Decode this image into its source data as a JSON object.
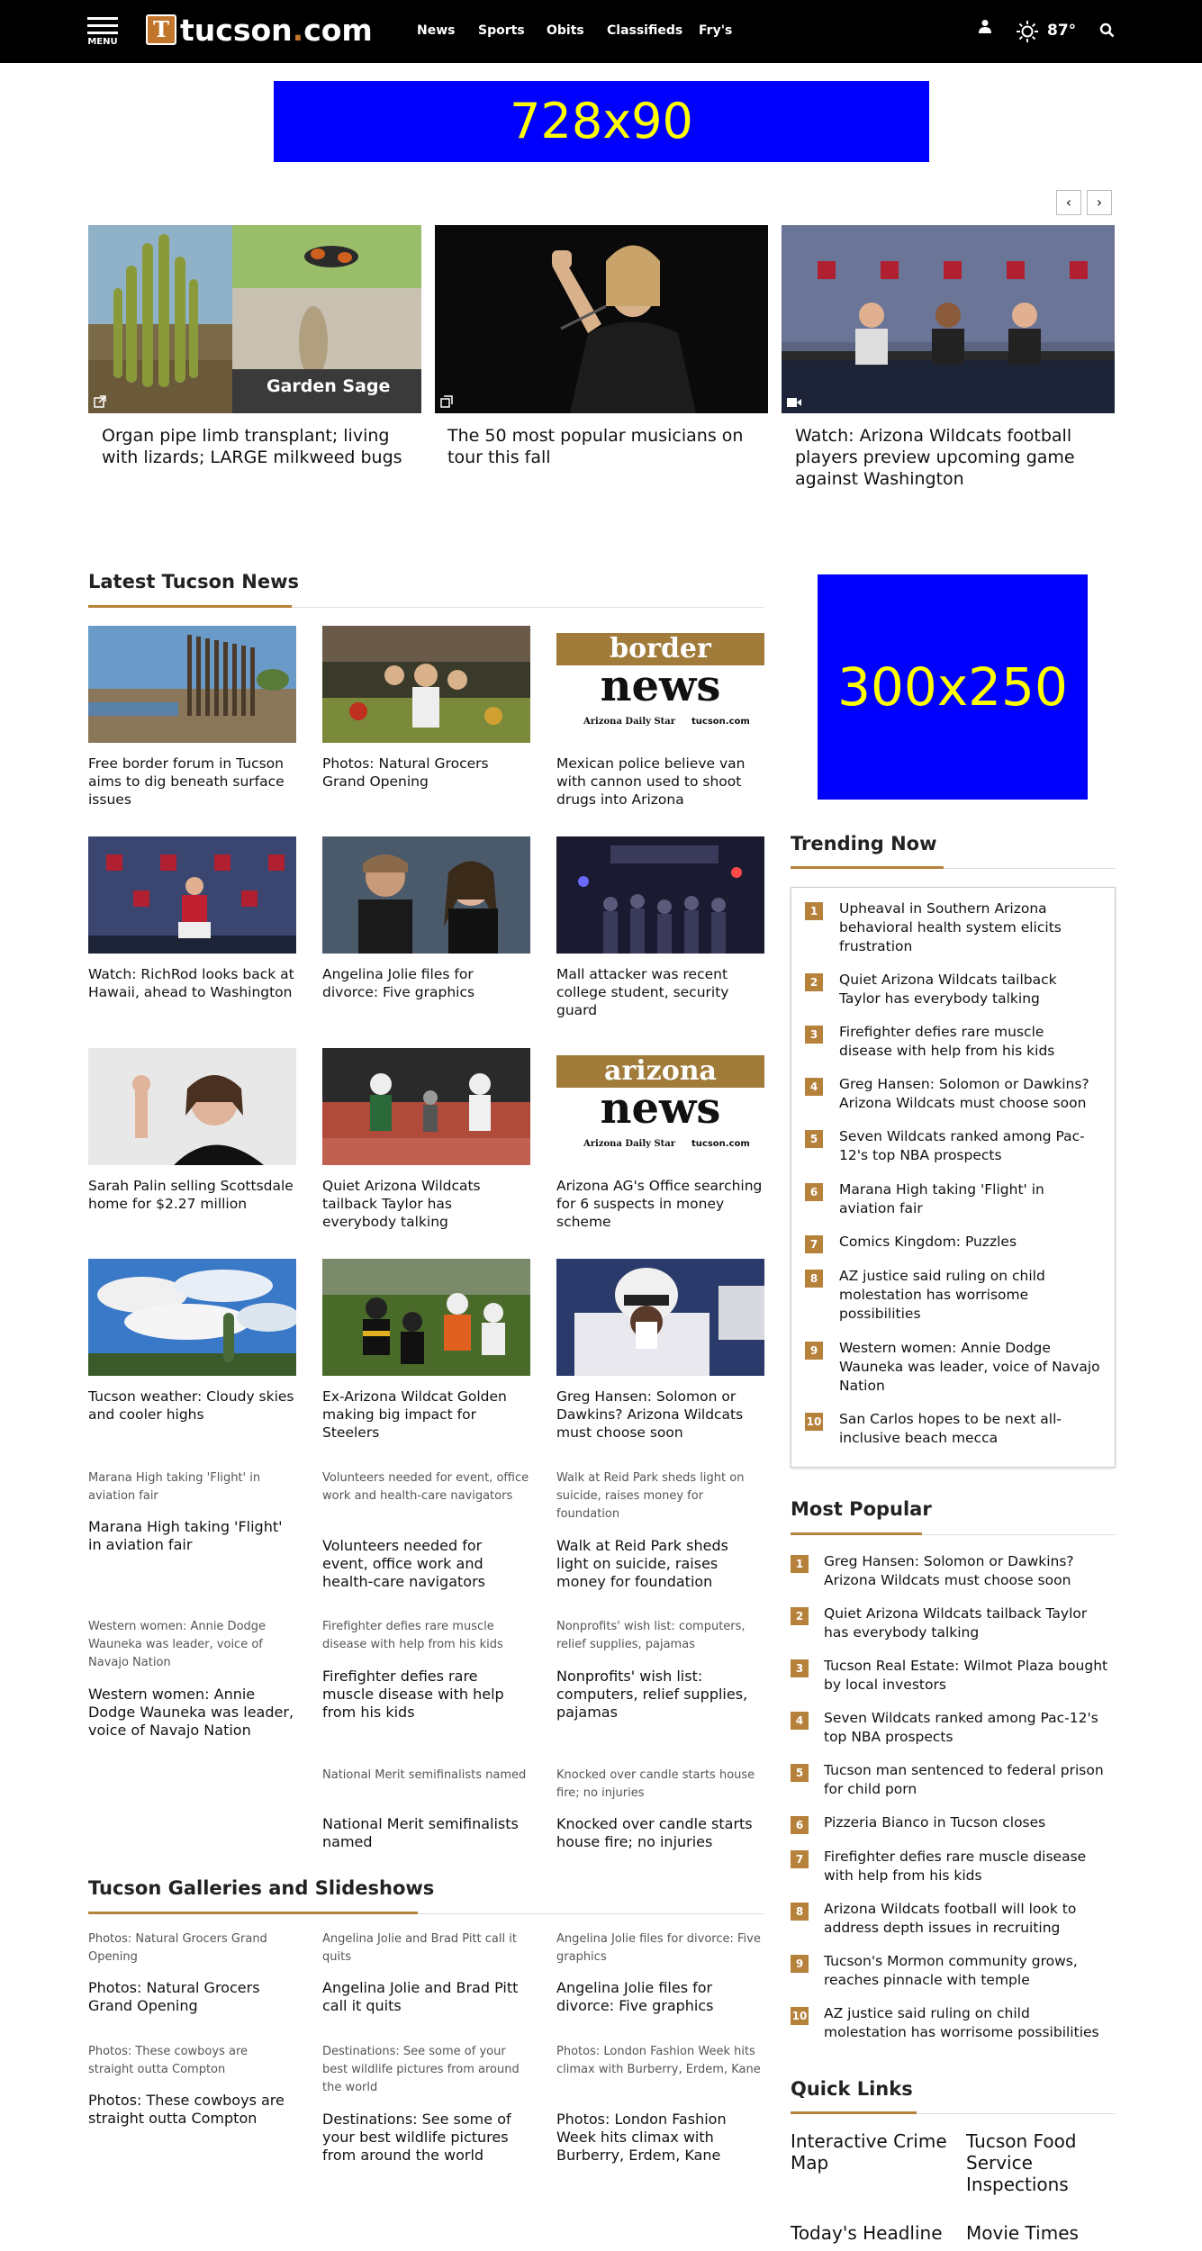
{
  "nav": {
    "menu_label": "MENU",
    "logo_letter": "T",
    "logo_name": "tucson",
    "logo_dot": ".",
    "logo_tld": "com",
    "links": [
      "News",
      "Sports",
      "Obits",
      "Classifieds",
      "Fry's"
    ],
    "temperature": "87°",
    "icons": [
      "hamburger-menu-icon",
      "user-icon",
      "sun-icon",
      "search-icon"
    ]
  },
  "ads": {
    "top": "728x90",
    "side": "300x250"
  },
  "carousel": {
    "prev": "‹",
    "next": "›",
    "items": [
      {
        "image_text": "Garden Sage",
        "caption": "Organ pipe limb transplant; living with lizards; LARGE milkweed bugs",
        "icon": "external-link-icon"
      },
      {
        "image_text": "",
        "caption": "The 50 most popular musicians on tour this fall",
        "icon": "gallery-icon"
      },
      {
        "image_text": "",
        "caption": "Watch: Arizona Wildcats football players preview upcoming game against Washington",
        "icon": "video-icon"
      }
    ]
  },
  "latest": {
    "title": "Latest Tucson News",
    "stories": [
      {
        "caption": "Free border forum in Tucson aims to dig beneath surface issues"
      },
      {
        "caption": "Photos: Natural Grocers Grand Opening"
      },
      {
        "caption": "Mexican police believe van with cannon used to shoot drugs into Arizona",
        "logo_top": "border",
        "logo_bottom": "news",
        "logo_sub1": "Arizona Daily Star",
        "logo_sub2": "tucson.com"
      },
      {
        "caption": "Watch: RichRod looks back at Hawaii, ahead to Washington"
      },
      {
        "caption": "Angelina Jolie files for divorce: Five graphics"
      },
      {
        "caption": "Mall attacker was recent college student, security guard"
      },
      {
        "caption": "Sarah Palin selling Scottsdale home for $2.27 million"
      },
      {
        "caption": "Quiet Arizona Wildcats tailback Taylor has everybody talking"
      },
      {
        "caption": "Arizona AG's Office searching for 6 suspects in money scheme",
        "logo_top": "arizona",
        "logo_bottom": "news",
        "logo_sub1": "Arizona Daily Star",
        "logo_sub2": "tucson.com"
      },
      {
        "caption": "Tucson weather: Cloudy skies and cooler highs"
      },
      {
        "caption": "Ex-Arizona Wildcat Golden making big impact for Steelers"
      },
      {
        "caption": "Greg Hansen: Solomon or Dawkins? Arizona Wildcats must choose soon"
      }
    ],
    "text_items": [
      {
        "kicker": "Marana High taking 'Flight' in aviation fair",
        "headline": "Marana High taking 'Flight' in aviation fair"
      },
      {
        "kicker": "Volunteers needed for event, office work and health-care navigators",
        "headline": "Volunteers needed for event, office work and health-care navigators"
      },
      {
        "kicker": "Walk at Reid Park sheds light on suicide, raises money for foundation",
        "headline": "Walk at Reid Park sheds light on suicide, raises money for foundation"
      },
      {
        "kicker": "Western women: Annie Dodge Wauneka was leader, voice of Navajo Nation",
        "headline": "Western women: Annie Dodge Wauneka was leader, voice of Navajo Nation"
      },
      {
        "kicker": "Firefighter defies rare muscle disease with help from his kids",
        "headline": "Firefighter defies rare muscle disease with help from his kids"
      },
      {
        "kicker": "Nonprofits' wish list: computers, relief supplies, pajamas",
        "headline": "Nonprofits' wish list: computers, relief supplies, pajamas"
      },
      {
        "kicker": "National Merit semifinalists named",
        "headline": "National Merit semifinalists named"
      },
      {
        "kicker": "Knocked over candle starts house fire; no injuries",
        "headline": "Knocked over candle starts house fire; no injuries"
      }
    ]
  },
  "galleries": {
    "title": "Tucson Galleries and Slideshows",
    "items": [
      {
        "kicker": "Photos: Natural Grocers Grand Opening",
        "headline": "Photos: Natural Grocers Grand Opening"
      },
      {
        "kicker": "Angelina Jolie and Brad Pitt call it quits",
        "headline": "Angelina Jolie and Brad Pitt call it quits"
      },
      {
        "kicker": "Angelina Jolie files for divorce: Five graphics",
        "headline": "Angelina Jolie files for divorce: Five graphics"
      },
      {
        "kicker": "Photos: These cowboys are straight outta Compton",
        "headline": "Photos: These cowboys are straight outta Compton"
      },
      {
        "kicker": "Destinations: See some of your best wildlife pictures from around the world",
        "headline": "Destinations: See some of your best wildlife pictures from around the world"
      },
      {
        "kicker": "Photos: London Fashion Week hits climax with Burberry, Erdem, Kane",
        "headline": "Photos: London Fashion Week hits climax with Burberry, Erdem, Kane"
      }
    ]
  },
  "trending": {
    "title": "Trending Now",
    "items": [
      {
        "n": "1",
        "text": "Upheaval in Southern Arizona behavioral health system elicits frustration"
      },
      {
        "n": "2",
        "text": "Quiet Arizona Wildcats tailback Taylor has everybody talking"
      },
      {
        "n": "3",
        "text": "Firefighter defies rare muscle disease with help from his kids"
      },
      {
        "n": "4",
        "text": "Greg Hansen: Solomon or Dawkins? Arizona Wildcats must choose soon"
      },
      {
        "n": "5",
        "text": "Seven Wildcats ranked among Pac-12's top NBA prospects"
      },
      {
        "n": "6",
        "text": "Marana High taking 'Flight' in aviation fair"
      },
      {
        "n": "7",
        "text": "Comics Kingdom: Puzzles"
      },
      {
        "n": "8",
        "text": "AZ justice said ruling on child molestation has worrisome possibilities"
      },
      {
        "n": "9",
        "text": "Western women: Annie Dodge Wauneka was leader, voice of Navajo Nation"
      },
      {
        "n": "10",
        "text": "San Carlos hopes to be next all-inclusive beach mecca"
      }
    ]
  },
  "popular": {
    "title": "Most Popular",
    "items": [
      {
        "n": "1",
        "text": "Greg Hansen: Solomon or Dawkins? Arizona Wildcats must choose soon"
      },
      {
        "n": "2",
        "text": "Quiet Arizona Wildcats tailback Taylor has everybody talking"
      },
      {
        "n": "3",
        "text": "Tucson Real Estate: Wilmot Plaza bought by local investors"
      },
      {
        "n": "4",
        "text": "Seven Wildcats ranked among Pac-12's top NBA prospects"
      },
      {
        "n": "5",
        "text": "Tucson man sentenced to federal prison for child porn"
      },
      {
        "n": "6",
        "text": "Pizzeria Bianco in Tucson closes"
      },
      {
        "n": "7",
        "text": "Firefighter defies rare muscle disease with help from his kids"
      },
      {
        "n": "8",
        "text": "Arizona Wildcats football will look to address depth issues in recruiting"
      },
      {
        "n": "9",
        "text": "Tucson's Mormon community grows, reaches pinnacle with temple"
      },
      {
        "n": "10",
        "text": "AZ justice said ruling on child molestation has worrisome possibilities"
      }
    ]
  },
  "quick_links": {
    "title": "Quick Links",
    "items": [
      "Interactive Crime Map",
      "Tucson Food Service Inspections",
      "Today's Headline",
      "Movie Times"
    ]
  },
  "colors": {
    "accent": "#b6813a",
    "nav_bg": "#000000",
    "ad_bg": "#0000ff",
    "ad_text": "#ffff00"
  }
}
